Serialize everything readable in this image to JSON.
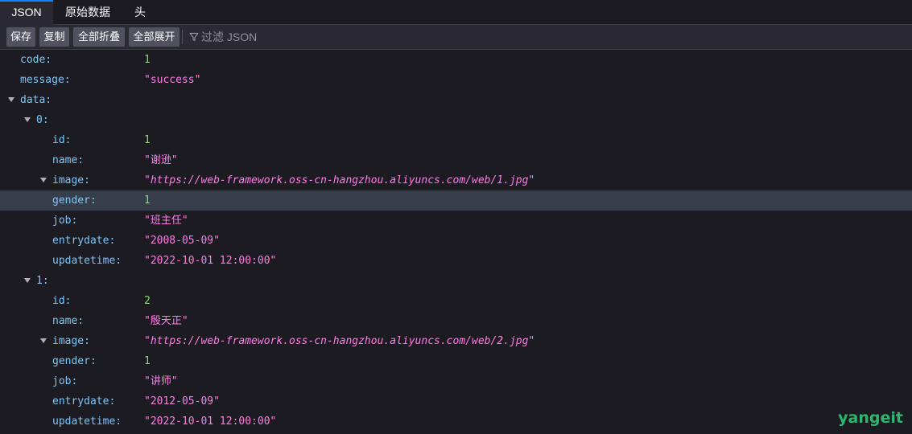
{
  "tabs": [
    {
      "label": "JSON",
      "active": true
    },
    {
      "label": "原始数据",
      "active": false
    },
    {
      "label": "头",
      "active": false
    }
  ],
  "toolbar": {
    "save": "保存",
    "copy": "复制",
    "collapse_all": "全部折叠",
    "expand_all": "全部展开",
    "filter_placeholder": "过滤 JSON",
    "filter_icon": "funnel-icon"
  },
  "rows": [
    {
      "key": "code:",
      "value": "1",
      "type": "num"
    },
    {
      "key": "message:",
      "value": "\"success\"",
      "type": "str"
    },
    {
      "key": "data:",
      "value": "",
      "type": "obj"
    },
    {
      "key": "0:",
      "value": "",
      "type": "obj"
    },
    {
      "key": "id:",
      "value": "1",
      "type": "num"
    },
    {
      "key": "name:",
      "value": "\"谢逊\"",
      "type": "str"
    },
    {
      "key": "image:",
      "value": "\"https://web-framework.oss-cn-hangzhou.aliyuncs.com/web/1.jpg\"",
      "type": "url"
    },
    {
      "key": "gender:",
      "value": "1",
      "type": "num",
      "selected": true
    },
    {
      "key": "job:",
      "value": "\"班主任\"",
      "type": "str"
    },
    {
      "key": "entrydate:",
      "value": "\"2008-05-09\"",
      "type": "str"
    },
    {
      "key": "updatetime:",
      "value": "\"2022-10-01 12:00:00\"",
      "type": "str"
    },
    {
      "key": "1:",
      "value": "",
      "type": "obj"
    },
    {
      "key": "id:",
      "value": "2",
      "type": "num"
    },
    {
      "key": "name:",
      "value": "\"殷天正\"",
      "type": "str"
    },
    {
      "key": "image:",
      "value": "\"https://web-framework.oss-cn-hangzhou.aliyuncs.com/web/2.jpg\"",
      "type": "url"
    },
    {
      "key": "gender:",
      "value": "1",
      "type": "num"
    },
    {
      "key": "job:",
      "value": "\"讲师\"",
      "type": "str"
    },
    {
      "key": "entrydate:",
      "value": "\"2012-05-09\"",
      "type": "str"
    },
    {
      "key": "updatetime:",
      "value": "\"2022-10-01 12:00:00\"",
      "type": "str"
    }
  ],
  "watermark": "yangeit",
  "colors": {
    "key": "#7fc6f8",
    "number": "#86de74",
    "string": "#ff7de9",
    "selected_row": "#363e4c",
    "accent": "#0a84ff",
    "watermark": "#2fb670"
  }
}
